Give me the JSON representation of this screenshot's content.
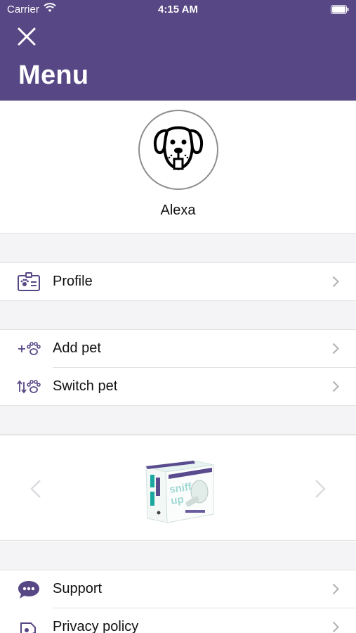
{
  "status_bar": {
    "carrier": "Carrier",
    "time": "4:15 AM"
  },
  "header": {
    "title": "Menu",
    "close_icon": "close-icon"
  },
  "user": {
    "name": "Alexa",
    "avatar_icon": "dog-face-icon"
  },
  "menu": {
    "profile": {
      "label": "Profile",
      "icon": "pet-id-card-icon"
    },
    "add_pet": {
      "label": "Add pet",
      "icon": "add-paw-icon"
    },
    "switch_pet": {
      "label": "Switch pet",
      "icon": "switch-paw-icon"
    },
    "support": {
      "label": "Support",
      "icon": "chat-bubble-icon"
    },
    "privacy": {
      "label": "Privacy policy",
      "icon": "privacy-document-icon"
    }
  },
  "carousel": {
    "product_text": "sniff up"
  },
  "colors": {
    "header_bg": "#574784",
    "icon_purple": "#574784",
    "section_bg": "#f4f4f6"
  }
}
